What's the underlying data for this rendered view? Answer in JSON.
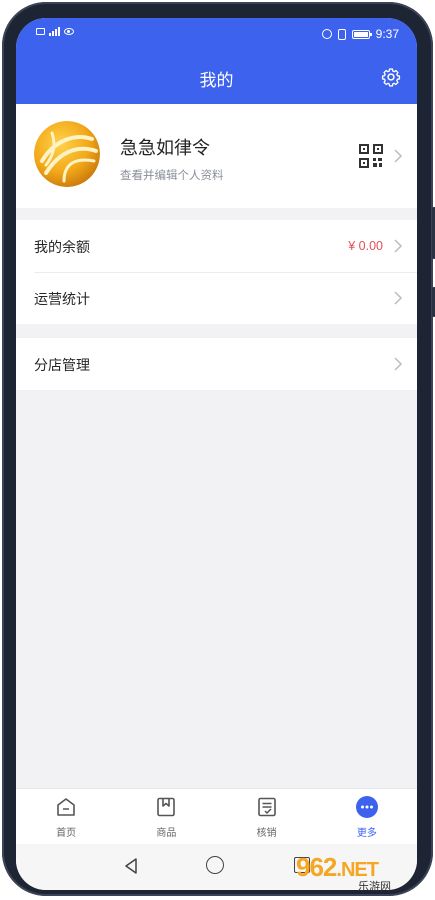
{
  "status_bar": {
    "time": "9:37"
  },
  "header": {
    "title": "我的"
  },
  "profile": {
    "name": "急急如律令",
    "subtitle": "查看并编辑个人资料"
  },
  "menu_groups": [
    {
      "items": [
        {
          "label": "我的余额",
          "value": "¥ 0.00"
        },
        {
          "label": "运营统计",
          "value": ""
        }
      ]
    },
    {
      "items": [
        {
          "label": "分店管理",
          "value": ""
        }
      ]
    }
  ],
  "tabbar": {
    "tabs": [
      {
        "label": "首页",
        "icon": "home-icon",
        "active": false
      },
      {
        "label": "商品",
        "icon": "bookmark-icon",
        "active": false
      },
      {
        "label": "核销",
        "icon": "document-icon",
        "active": false
      },
      {
        "label": "更多",
        "icon": "more-icon",
        "active": true
      }
    ]
  },
  "watermark": {
    "logo": "962",
    "logo_suffix": ".NET",
    "caption": "乐游网"
  },
  "colors": {
    "accent": "#3d63ee",
    "balance": "#e0505a",
    "background": "#f2f2f5"
  }
}
